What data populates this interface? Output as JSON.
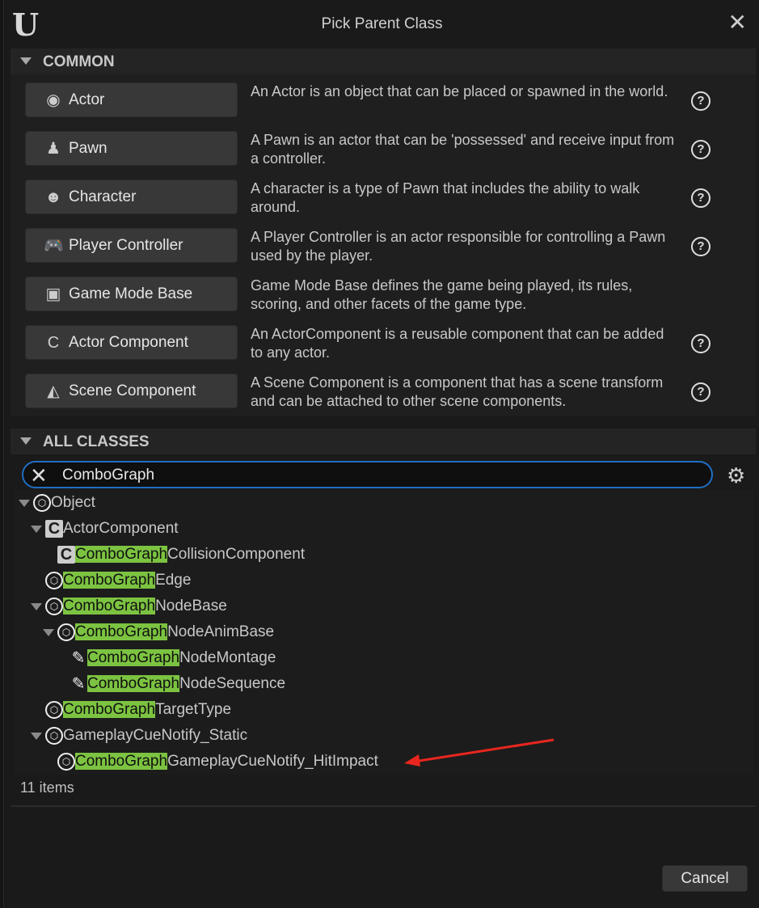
{
  "window": {
    "title": "Pick Parent Class",
    "logo": "U"
  },
  "common": {
    "header": "COMMON",
    "items": [
      {
        "label": "Actor",
        "icon": "actor-icon",
        "glyph": "◉",
        "desc": "An Actor is an object that can be placed or spawned in the world.",
        "help": true
      },
      {
        "label": "Pawn",
        "icon": "pawn-icon",
        "glyph": "♟",
        "desc": "A Pawn is an actor that can be 'possessed' and receive input from a controller.",
        "help": true
      },
      {
        "label": "Character",
        "icon": "character-icon",
        "glyph": "☻",
        "desc": "A character is a type of Pawn that includes the ability to walk around.",
        "help": true
      },
      {
        "label": "Player Controller",
        "icon": "gamepad-icon",
        "glyph": "🎮",
        "desc": "A Player Controller is an actor responsible for controlling a Pawn used by the player.",
        "help": true
      },
      {
        "label": "Game Mode Base",
        "icon": "game-mode-icon",
        "glyph": "▣",
        "desc": "Game Mode Base defines the game being played, its rules, scoring, and other facets of the game type.",
        "help": false
      },
      {
        "label": "Actor Component",
        "icon": "component-icon",
        "glyph": "C",
        "desc": "An ActorComponent is a reusable component that can be added to any actor.",
        "help": true
      },
      {
        "label": "Scene Component",
        "icon": "scene-component-icon",
        "glyph": "◭",
        "desc": "A Scene Component is a component that has a scene transform and can be attached to other scene components.",
        "help": true
      }
    ],
    "help_glyph": "?"
  },
  "all_classes": {
    "header": "ALL CLASSES",
    "search_value": "ComboGraph",
    "tree": [
      {
        "hl": "",
        "rest": "Object",
        "level": 0,
        "expanded": true,
        "icon": "object"
      },
      {
        "hl": "",
        "rest": "ActorComponent",
        "level": 1,
        "expanded": true,
        "icon": "component"
      },
      {
        "hl": "ComboGraph",
        "rest": "CollisionComponent",
        "level": 2,
        "expanded": null,
        "icon": "component"
      },
      {
        "hl": "ComboGraph",
        "rest": "Edge",
        "level": 1,
        "expanded": null,
        "icon": "object"
      },
      {
        "hl": "ComboGraph",
        "rest": "NodeBase",
        "level": 1,
        "expanded": true,
        "icon": "object"
      },
      {
        "hl": "ComboGraph",
        "rest": "NodeAnimBase",
        "level": 2,
        "expanded": true,
        "icon": "object"
      },
      {
        "hl": "ComboGraph",
        "rest": "NodeMontage",
        "level": 3,
        "expanded": null,
        "icon": "montage"
      },
      {
        "hl": "ComboGraph",
        "rest": "NodeSequence",
        "level": 3,
        "expanded": null,
        "icon": "montage"
      },
      {
        "hl": "ComboGraph",
        "rest": "TargetType",
        "level": 1,
        "expanded": null,
        "icon": "object"
      },
      {
        "hl": "",
        "rest": "GameplayCueNotify_Static",
        "level": 1,
        "expanded": true,
        "icon": "object"
      },
      {
        "hl": "ComboGraph",
        "rest": "GameplayCueNotify_HitImpact",
        "level": 2,
        "expanded": null,
        "icon": "object"
      }
    ],
    "count": "11 items"
  },
  "footer": {
    "cancel": "Cancel"
  },
  "colors": {
    "highlight": "#7cc341",
    "search_border": "#1f6fc4",
    "annotation_arrow": "#e8261e"
  }
}
